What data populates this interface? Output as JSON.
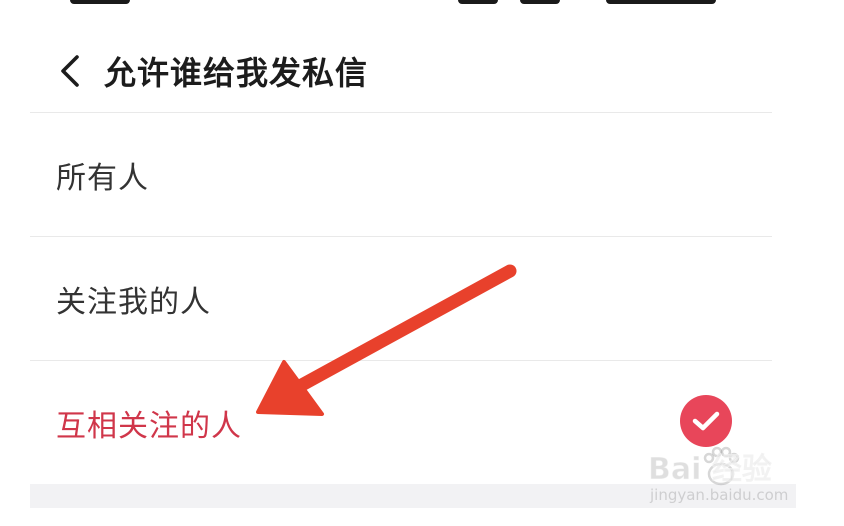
{
  "header": {
    "back_icon": "chevron-left-icon",
    "title": "允许谁给我发私信"
  },
  "options": [
    {
      "label": "所有人",
      "selected": false
    },
    {
      "label": "关注我的人",
      "selected": false
    },
    {
      "label": "互相关注的人",
      "selected": true
    }
  ],
  "selected_check_icon": "check-circle-icon",
  "annotation_arrow_icon": "red-arrow-icon",
  "watermark": {
    "main": "Bai 经验",
    "sub": "jingyan.baidu.com"
  },
  "colors": {
    "accent": "#d0364a",
    "check_fill": "#e8465a",
    "arrow": "#e8412c",
    "divider": "#e9e9e9",
    "title_text": "#1c1c1c",
    "option_text": "#333333"
  }
}
